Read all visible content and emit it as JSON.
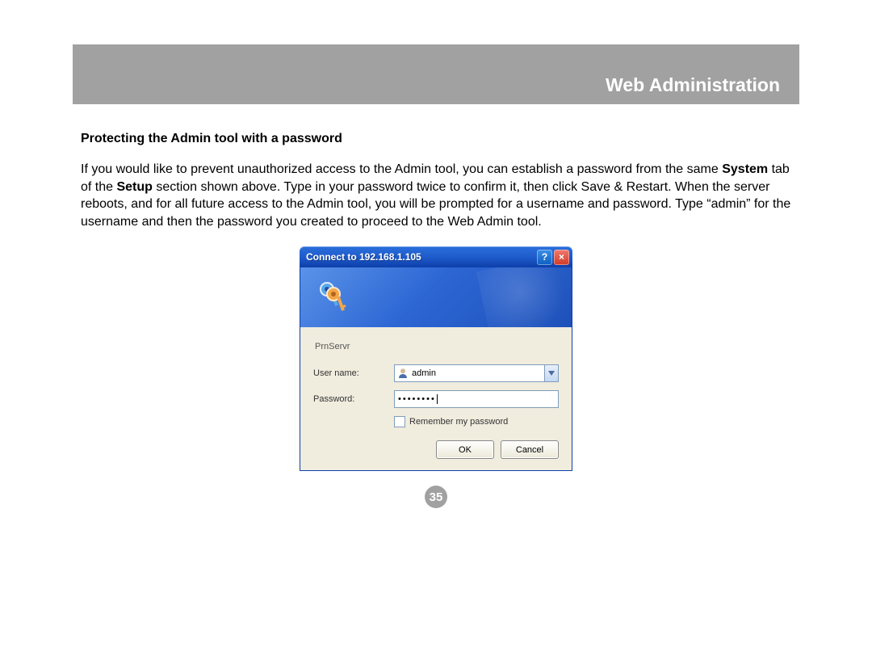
{
  "header": {
    "title": "Web Administration"
  },
  "section": {
    "heading": "Protecting the Admin tool with a password",
    "paragraph_pre": "If you would like to prevent unauthorized access to the Admin tool, you can establish a password from the same ",
    "bold1": "System",
    "mid1": " tab of the ",
    "bold2": "Setup",
    "paragraph_post": " section shown above.  Type in your password twice to confirm it, then click Save & Restart.  When the server reboots, and for all future access to the Admin tool, you will be prompted for a username and password.  Type “admin” for the username and then the password you created to proceed to the Web Admin tool."
  },
  "dialog": {
    "title": "Connect to 192.168.1.105",
    "help_glyph": "?",
    "close_glyph": "×",
    "realm": "PrnServr",
    "username_label": "User name:",
    "username_value": "admin",
    "password_label": "Password:",
    "password_mask": "••••••••",
    "remember_label": "Remember my password",
    "ok_label": "OK",
    "cancel_label": "Cancel"
  },
  "page_number": "35"
}
